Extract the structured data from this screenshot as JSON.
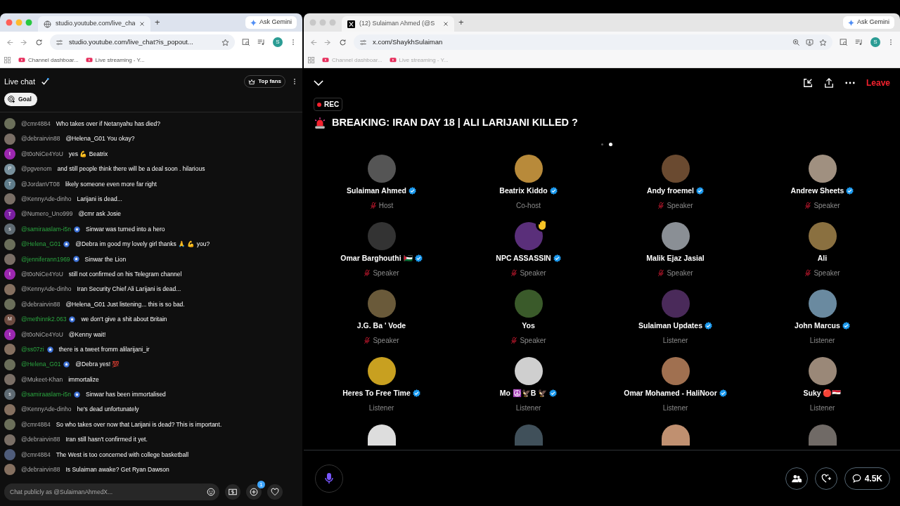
{
  "windows": [
    {
      "active": true,
      "tab": {
        "title": "studio.youtube.com/live_cha"
      },
      "new_tab": "+",
      "gemini": "Ask Gemini",
      "url": "studio.youtube.com/live_chat?is_popout...",
      "profile": "S",
      "bookmarks": [
        "Channel dashboar...",
        "Live streaming - Y..."
      ]
    },
    {
      "active": false,
      "tab": {
        "title": "(12) Sulaiman Ahmed (@S"
      },
      "new_tab": "+",
      "gemini": "Ask Gemini",
      "url": "x.com/ShaykhSulaiman",
      "profile": "S",
      "bookmarks": [
        "Channel dashboar...",
        "Live streaming - Y..."
      ]
    }
  ],
  "chat": {
    "title": "Live chat",
    "top_fans": "Top fans",
    "goal": "Goal",
    "messages": [
      {
        "author": "@cmr4884",
        "member": false,
        "avatar": {
          "kind": "photo"
        },
        "text": "Who takes over if Netanyahu has died?"
      },
      {
        "author": "@debrairvin88",
        "member": false,
        "avatar": {
          "kind": "photo"
        },
        "text": "@Helena_G01 You okay?"
      },
      {
        "author": "@t0oNiCe4YoU",
        "member": false,
        "avatar": {
          "kind": "letter",
          "letter": "t",
          "color": "#9c27b0"
        },
        "text": "yes 💪 Beatrix"
      },
      {
        "author": "@pgvenom",
        "member": false,
        "avatar": {
          "kind": "letter",
          "letter": "P",
          "color": "#78909c"
        },
        "text": "and still people think there will be a deal soon . hilarious"
      },
      {
        "author": "@JordanVT08",
        "member": false,
        "avatar": {
          "kind": "letter",
          "letter": "T",
          "color": "#607d8b"
        },
        "text": "likely someone even more far right"
      },
      {
        "author": "@KennyAde-dinho",
        "member": false,
        "avatar": {
          "kind": "photo"
        },
        "text": "Larijani is dead..."
      },
      {
        "author": "@Numero_Uno999",
        "member": false,
        "avatar": {
          "kind": "letter",
          "letter": "T",
          "color": "#7b1fa2"
        },
        "text": "@cmr ask Josie"
      },
      {
        "author": "@samiraaslam-i5n",
        "member": true,
        "avatar": {
          "kind": "letter",
          "letter": "s",
          "color": "#5f6b73"
        },
        "text": "Sinwar was turned into a hero"
      },
      {
        "author": "@Helena_G01",
        "member": true,
        "avatar": {
          "kind": "photo"
        },
        "text": "@Debra im good my lovely girl thanks 🙏 💪 you?"
      },
      {
        "author": "@jenniferann1969",
        "member": true,
        "avatar": {
          "kind": "photo"
        },
        "text": "Sinwar the Lion"
      },
      {
        "author": "@t0oNiCe4YoU",
        "member": false,
        "avatar": {
          "kind": "letter",
          "letter": "t",
          "color": "#9c27b0"
        },
        "text": "still not confirmed on his Telegram channel"
      },
      {
        "author": "@KennyAde-dinho",
        "member": false,
        "avatar": {
          "kind": "photo"
        },
        "text": "Iran Security Chief Ali Larijani is dead..."
      },
      {
        "author": "@debrairvin88",
        "member": false,
        "avatar": {
          "kind": "photo"
        },
        "text": "@Helena_G01 Just listening... this is so bad."
      },
      {
        "author": "@methinnk2.063",
        "member": true,
        "avatar": {
          "kind": "letter",
          "letter": "M",
          "color": "#6d4c41"
        },
        "text": "we don't give a shit about Britain"
      },
      {
        "author": "@t0oNiCe4YoU",
        "member": false,
        "avatar": {
          "kind": "letter",
          "letter": "t",
          "color": "#9c27b0"
        },
        "text": "@Kenny wait!"
      },
      {
        "author": "@ss07zi",
        "member": true,
        "avatar": {
          "kind": "photo"
        },
        "text": "there is a tweet fromm alilarijani_ir"
      },
      {
        "author": "@Helena_G01",
        "member": true,
        "avatar": {
          "kind": "photo"
        },
        "text": "@Debra yes! 💯"
      },
      {
        "author": "@Mukeet-Khan",
        "member": false,
        "avatar": {
          "kind": "photo"
        },
        "text": "immortalize"
      },
      {
        "author": "@samiraaslam-i5n",
        "member": true,
        "avatar": {
          "kind": "letter",
          "letter": "s",
          "color": "#5f6b73"
        },
        "text": "Sinwar has been immortalised"
      },
      {
        "author": "@KennyAde-dinho",
        "member": false,
        "avatar": {
          "kind": "photo"
        },
        "text": "he's dead unfortunately"
      },
      {
        "author": "@cmr4884",
        "member": false,
        "avatar": {
          "kind": "photo"
        },
        "text": "So who takes over now that Larijani is dead? This is important."
      },
      {
        "author": "@debrairvin88",
        "member": false,
        "avatar": {
          "kind": "photo"
        },
        "text": "Iran still hasn't confirmed it yet."
      },
      {
        "author": "@cmr4884",
        "member": false,
        "avatar": {
          "kind": "photo"
        },
        "text": "The West is too concerned with college basketball"
      },
      {
        "author": "@debrairvin88",
        "member": false,
        "avatar": {
          "kind": "photo"
        },
        "text": "Is Sulaiman awake? Get Ryan Dawson"
      }
    ],
    "input": {
      "placeholder": "Chat publicly as @SulaimanAhmedX..."
    },
    "notification_count": "1"
  },
  "space": {
    "leave": "Leave",
    "rec": "REC",
    "title": "BREAKING: IRAN DAY 18 | ALI LARIJANI KILLED ?",
    "pages": [
      {
        "selected": false
      },
      {
        "selected": true
      }
    ],
    "participants": [
      {
        "name": "Sulaiman Ahmed",
        "verified": true,
        "role": "Host",
        "muted": true,
        "hand_raised": false
      },
      {
        "name": "Beatrix Kiddo",
        "verified": true,
        "role": "Co-host",
        "muted": false,
        "hand_raised": false
      },
      {
        "name": "Andy froemel",
        "verified": true,
        "role": "Speaker",
        "muted": true,
        "hand_raised": false
      },
      {
        "name": "Andrew Sheets",
        "verified": true,
        "role": "Speaker",
        "muted": true,
        "hand_raised": false
      },
      {
        "name": "Omar Barghouthi 🇵🇸",
        "verified": true,
        "role": "Speaker",
        "muted": true,
        "hand_raised": false
      },
      {
        "name": "NPC ASSASSIN",
        "verified": true,
        "role": "Speaker",
        "muted": true,
        "hand_raised": true
      },
      {
        "name": "Malik Ejaz Jasial",
        "verified": false,
        "role": "Speaker",
        "muted": true,
        "hand_raised": false
      },
      {
        "name": "Ali",
        "verified": false,
        "role": "Speaker",
        "muted": true,
        "hand_raised": false
      },
      {
        "name": "J.G. Ba ' Vode",
        "verified": false,
        "role": "Speaker",
        "muted": true,
        "hand_raised": false
      },
      {
        "name": "Yos",
        "verified": false,
        "role": "Speaker",
        "muted": true,
        "hand_raised": false
      },
      {
        "name": "Sulaiman Updates",
        "verified": true,
        "role": "Listener",
        "muted": false,
        "hand_raised": false
      },
      {
        "name": "John Marcus",
        "verified": true,
        "role": "Listener",
        "muted": false,
        "hand_raised": false
      },
      {
        "name": "Heres To Free Time",
        "verified": true,
        "role": "Listener",
        "muted": false,
        "hand_raised": false
      },
      {
        "name": "Mo ☮️🦅B 🦅",
        "verified": true,
        "role": "Listener",
        "muted": false,
        "hand_raised": false
      },
      {
        "name": "Omar Mohamed - HaliNoor",
        "verified": true,
        "role": "Listener",
        "muted": false,
        "hand_raised": false
      },
      {
        "name": "Suky 🔴🇪🇬",
        "verified": false,
        "role": "Listener",
        "muted": false,
        "hand_raised": false
      }
    ],
    "cut_off_avatars": [
      {
        "kind": "photo"
      },
      {
        "kind": "photo"
      },
      {
        "kind": "photo"
      },
      {
        "kind": "photo"
      }
    ],
    "comments": "4.5K"
  }
}
